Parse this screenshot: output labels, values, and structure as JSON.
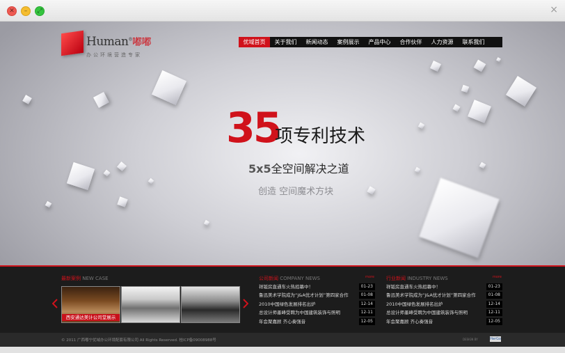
{
  "window": {
    "close_glyph": "×"
  },
  "logo": {
    "brand": "Human",
    "brand_cn": "嘟嘟",
    "registered": "®",
    "slogan": "办公环境营造专家"
  },
  "nav": {
    "items": [
      "优域首页",
      "关于我们",
      "新闻动态",
      "案例展示",
      "产品中心",
      "合作伙伴",
      "人力资源",
      "联系我们"
    ],
    "active_index": 0
  },
  "banner": {
    "number": "35",
    "headline": "项专利技术",
    "sub_bold": "5x5",
    "sub_rest": "全空间解决之道",
    "tagline": "创造 空间魔术方块"
  },
  "cases": {
    "title_cn": "最新案例",
    "title_en": "NEW CASE",
    "caption": "西安通达美计公司堂展示",
    "prev_icon": "chevron-left-icon",
    "next_icon": "chevron-right-icon"
  },
  "company_news": {
    "title_cn": "公司新闻",
    "title_en": "COMPANY NEWS",
    "more": "more",
    "items": [
      {
        "title": "祥钣房直通车火热招幕中！",
        "date": "01-23"
      },
      {
        "title": "鲁迅美术学院成为“J&A优才计划”第四家合作",
        "date": "01-08"
      },
      {
        "title": "2010中国绿色发展排名出炉",
        "date": "12-14"
      },
      {
        "title": "总设计师墨峰受聘为中国建筑装饰与照明",
        "date": "12-11"
      },
      {
        "title": "年会聚嘉顾 齐心奏强音",
        "date": "12-05"
      }
    ]
  },
  "industry_news": {
    "title_cn": "行业新闻",
    "title_en": "INDUSTRY NEWS",
    "more": "more",
    "items": [
      {
        "title": "祥钣房直通车火热招幕中！",
        "date": "01-23"
      },
      {
        "title": "鲁迅美术学院成为“J&A优才计划”第四家合作",
        "date": "01-08"
      },
      {
        "title": "2010中国绿色发展排名出炉",
        "date": "12-14"
      },
      {
        "title": "总设计师墨峰受聘为中国建筑装饰与照明",
        "date": "12-11"
      },
      {
        "title": "年会聚嘉顾 齐心奏强音",
        "date": "12-05"
      }
    ]
  },
  "footer": {
    "copyright": "© 2011 广西嘟宁优域办公环境配套有限公司 All Rights Reserved.  桂ICP备09008988号",
    "design_by": "DESIGN BY",
    "badge": "HerGo"
  },
  "colors": {
    "accent": "#d0121b",
    "nav_bg": "#111111",
    "lower_bg": "#1c1c1c"
  }
}
